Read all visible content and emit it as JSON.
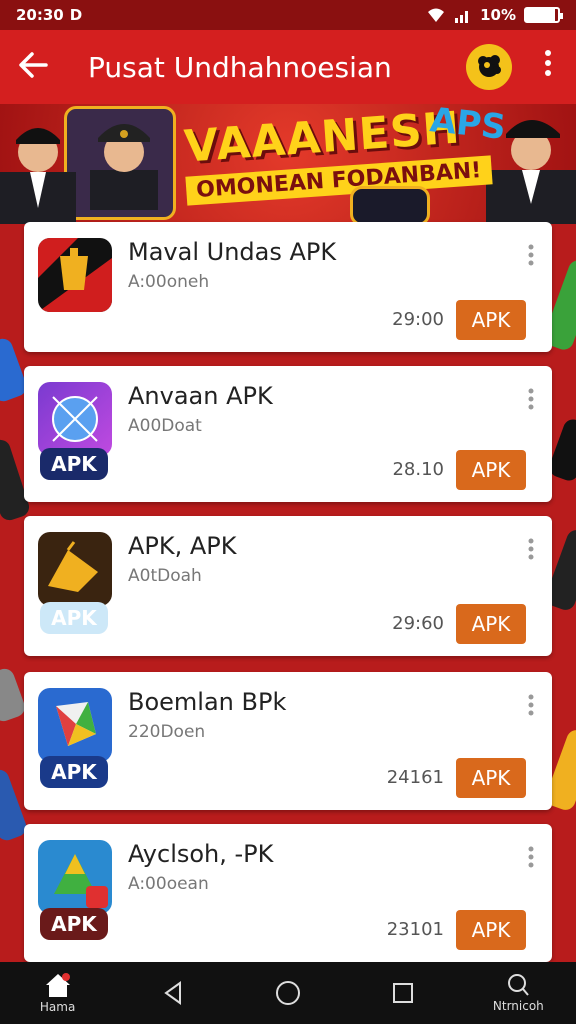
{
  "status_bar": {
    "time": "20:30",
    "carrier_icon": "D",
    "battery_text": "10%",
    "battery_level": 0.9
  },
  "app_bar": {
    "title": "Pusat Undhahnoesian",
    "back_icon": "arrow-left-icon",
    "profile_icon": "profile-icon",
    "more_icon": "more-vert-icon"
  },
  "banner": {
    "title": "VAAANESH",
    "subtitle": "OMONEAN FODANBAN!",
    "tag": "APS"
  },
  "apps": [
    {
      "name": "Maval Undas APK",
      "meta": "A:00oneh",
      "count": "29:00",
      "button": "APK",
      "badge": ""
    },
    {
      "name": "Anvaan APK",
      "meta": "A00Doat",
      "count": "28.10",
      "button": "APK",
      "badge": "APK"
    },
    {
      "name": "APK, APK",
      "meta": "A0tDoah",
      "count": "29:60",
      "button": "APK",
      "badge": "APK"
    },
    {
      "name": "Boemlan BPk",
      "meta": "220Doen",
      "count": "24161",
      "button": "APK",
      "badge": "APK"
    },
    {
      "name": "Ayclsoh, -PK",
      "meta": "A:00oean",
      "count": "23101",
      "button": "APK",
      "badge": "APK"
    }
  ],
  "bottom_nav": {
    "home_label": "Hama",
    "search_label": "Ntrnicoh"
  },
  "colors": {
    "app_bar": "#d41f1f",
    "button": "#d9691c",
    "background": "#b81c1c"
  }
}
